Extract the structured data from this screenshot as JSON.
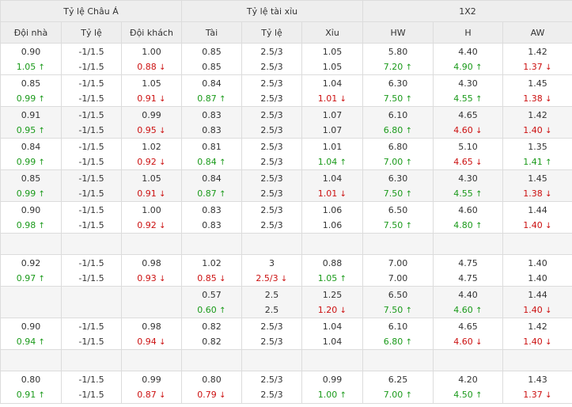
{
  "groups": [
    "Tỷ lệ Châu Á",
    "Tỷ lệ tài xỉu",
    "1X2"
  ],
  "columns": [
    "Đội nhà",
    "Tỷ lệ",
    "Đội khách",
    "Tài",
    "Tỷ lệ",
    "Xỉu",
    "HW",
    "H",
    "AW"
  ],
  "rows": [
    {
      "type": "data",
      "alt": false,
      "cells": [
        [
          {
            "v": "0.90",
            "c": ""
          },
          {
            "v": "1.05",
            "c": "up"
          }
        ],
        [
          {
            "v": "-1/1.5",
            "c": ""
          },
          {
            "v": "-1/1.5",
            "c": ""
          }
        ],
        [
          {
            "v": "1.00",
            "c": ""
          },
          {
            "v": "0.88",
            "c": "down"
          }
        ],
        [
          {
            "v": "0.85",
            "c": ""
          },
          {
            "v": "0.85",
            "c": ""
          }
        ],
        [
          {
            "v": "2.5/3",
            "c": ""
          },
          {
            "v": "2.5/3",
            "c": ""
          }
        ],
        [
          {
            "v": "1.05",
            "c": ""
          },
          {
            "v": "1.05",
            "c": ""
          }
        ],
        [
          {
            "v": "5.80",
            "c": ""
          },
          {
            "v": "7.20",
            "c": "up"
          }
        ],
        [
          {
            "v": "4.40",
            "c": ""
          },
          {
            "v": "4.90",
            "c": "up"
          }
        ],
        [
          {
            "v": "1.42",
            "c": ""
          },
          {
            "v": "1.37",
            "c": "down"
          }
        ]
      ]
    },
    {
      "type": "data",
      "alt": false,
      "cells": [
        [
          {
            "v": "0.85",
            "c": ""
          },
          {
            "v": "0.99",
            "c": "up"
          }
        ],
        [
          {
            "v": "-1/1.5",
            "c": ""
          },
          {
            "v": "-1/1.5",
            "c": ""
          }
        ],
        [
          {
            "v": "1.05",
            "c": ""
          },
          {
            "v": "0.91",
            "c": "down"
          }
        ],
        [
          {
            "v": "0.84",
            "c": ""
          },
          {
            "v": "0.87",
            "c": "up"
          }
        ],
        [
          {
            "v": "2.5/3",
            "c": ""
          },
          {
            "v": "2.5/3",
            "c": ""
          }
        ],
        [
          {
            "v": "1.04",
            "c": ""
          },
          {
            "v": "1.01",
            "c": "down"
          }
        ],
        [
          {
            "v": "6.30",
            "c": ""
          },
          {
            "v": "7.50",
            "c": "up"
          }
        ],
        [
          {
            "v": "4.30",
            "c": ""
          },
          {
            "v": "4.55",
            "c": "up"
          }
        ],
        [
          {
            "v": "1.45",
            "c": ""
          },
          {
            "v": "1.38",
            "c": "down"
          }
        ]
      ]
    },
    {
      "type": "data",
      "alt": true,
      "cells": [
        [
          {
            "v": "0.91",
            "c": ""
          },
          {
            "v": "0.95",
            "c": "up"
          }
        ],
        [
          {
            "v": "-1/1.5",
            "c": ""
          },
          {
            "v": "-1/1.5",
            "c": ""
          }
        ],
        [
          {
            "v": "0.99",
            "c": ""
          },
          {
            "v": "0.95",
            "c": "down"
          }
        ],
        [
          {
            "v": "0.83",
            "c": ""
          },
          {
            "v": "0.83",
            "c": ""
          }
        ],
        [
          {
            "v": "2.5/3",
            "c": ""
          },
          {
            "v": "2.5/3",
            "c": ""
          }
        ],
        [
          {
            "v": "1.07",
            "c": ""
          },
          {
            "v": "1.07",
            "c": ""
          }
        ],
        [
          {
            "v": "6.10",
            "c": ""
          },
          {
            "v": "6.80",
            "c": "up"
          }
        ],
        [
          {
            "v": "4.65",
            "c": ""
          },
          {
            "v": "4.60",
            "c": "down"
          }
        ],
        [
          {
            "v": "1.42",
            "c": ""
          },
          {
            "v": "1.40",
            "c": "down"
          }
        ]
      ]
    },
    {
      "type": "data",
      "alt": false,
      "cells": [
        [
          {
            "v": "0.84",
            "c": ""
          },
          {
            "v": "0.99",
            "c": "up"
          }
        ],
        [
          {
            "v": "-1/1.5",
            "c": ""
          },
          {
            "v": "-1/1.5",
            "c": ""
          }
        ],
        [
          {
            "v": "1.02",
            "c": ""
          },
          {
            "v": "0.92",
            "c": "down"
          }
        ],
        [
          {
            "v": "0.81",
            "c": ""
          },
          {
            "v": "0.84",
            "c": "up"
          }
        ],
        [
          {
            "v": "2.5/3",
            "c": ""
          },
          {
            "v": "2.5/3",
            "c": ""
          }
        ],
        [
          {
            "v": "1.01",
            "c": ""
          },
          {
            "v": "1.04",
            "c": "up"
          }
        ],
        [
          {
            "v": "6.80",
            "c": ""
          },
          {
            "v": "7.00",
            "c": "up"
          }
        ],
        [
          {
            "v": "5.10",
            "c": ""
          },
          {
            "v": "4.65",
            "c": "down"
          }
        ],
        [
          {
            "v": "1.35",
            "c": ""
          },
          {
            "v": "1.41",
            "c": "up"
          }
        ]
      ]
    },
    {
      "type": "data",
      "alt": true,
      "cells": [
        [
          {
            "v": "0.85",
            "c": ""
          },
          {
            "v": "0.99",
            "c": "up"
          }
        ],
        [
          {
            "v": "-1/1.5",
            "c": ""
          },
          {
            "v": "-1/1.5",
            "c": ""
          }
        ],
        [
          {
            "v": "1.05",
            "c": ""
          },
          {
            "v": "0.91",
            "c": "down"
          }
        ],
        [
          {
            "v": "0.84",
            "c": ""
          },
          {
            "v": "0.87",
            "c": "up"
          }
        ],
        [
          {
            "v": "2.5/3",
            "c": ""
          },
          {
            "v": "2.5/3",
            "c": ""
          }
        ],
        [
          {
            "v": "1.04",
            "c": ""
          },
          {
            "v": "1.01",
            "c": "down"
          }
        ],
        [
          {
            "v": "6.30",
            "c": ""
          },
          {
            "v": "7.50",
            "c": "up"
          }
        ],
        [
          {
            "v": "4.30",
            "c": ""
          },
          {
            "v": "4.55",
            "c": "up"
          }
        ],
        [
          {
            "v": "1.45",
            "c": ""
          },
          {
            "v": "1.38",
            "c": "down"
          }
        ]
      ]
    },
    {
      "type": "data",
      "alt": false,
      "cells": [
        [
          {
            "v": "0.90",
            "c": ""
          },
          {
            "v": "0.98",
            "c": "up"
          }
        ],
        [
          {
            "v": "-1/1.5",
            "c": ""
          },
          {
            "v": "-1/1.5",
            "c": ""
          }
        ],
        [
          {
            "v": "1.00",
            "c": ""
          },
          {
            "v": "0.92",
            "c": "down"
          }
        ],
        [
          {
            "v": "0.83",
            "c": ""
          },
          {
            "v": "0.83",
            "c": ""
          }
        ],
        [
          {
            "v": "2.5/3",
            "c": ""
          },
          {
            "v": "2.5/3",
            "c": ""
          }
        ],
        [
          {
            "v": "1.06",
            "c": ""
          },
          {
            "v": "1.06",
            "c": ""
          }
        ],
        [
          {
            "v": "6.50",
            "c": ""
          },
          {
            "v": "7.50",
            "c": "up"
          }
        ],
        [
          {
            "v": "4.60",
            "c": ""
          },
          {
            "v": "4.80",
            "c": "up"
          }
        ],
        [
          {
            "v": "1.44",
            "c": ""
          },
          {
            "v": "1.40",
            "c": "down"
          }
        ]
      ]
    },
    {
      "type": "blank",
      "alt": true
    },
    {
      "type": "data",
      "alt": false,
      "cells": [
        [
          {
            "v": "0.92",
            "c": ""
          },
          {
            "v": "0.97",
            "c": "up"
          }
        ],
        [
          {
            "v": "-1/1.5",
            "c": ""
          },
          {
            "v": "-1/1.5",
            "c": ""
          }
        ],
        [
          {
            "v": "0.98",
            "c": ""
          },
          {
            "v": "0.93",
            "c": "down"
          }
        ],
        [
          {
            "v": "1.02",
            "c": ""
          },
          {
            "v": "0.85",
            "c": "down"
          }
        ],
        [
          {
            "v": "3",
            "c": ""
          },
          {
            "v": "2.5/3",
            "c": "down"
          }
        ],
        [
          {
            "v": "0.88",
            "c": ""
          },
          {
            "v": "1.05",
            "c": "up"
          }
        ],
        [
          {
            "v": "7.00",
            "c": ""
          },
          {
            "v": "7.00",
            "c": ""
          }
        ],
        [
          {
            "v": "4.75",
            "c": ""
          },
          {
            "v": "4.75",
            "c": ""
          }
        ],
        [
          {
            "v": "1.40",
            "c": ""
          },
          {
            "v": "1.40",
            "c": ""
          }
        ]
      ]
    },
    {
      "type": "data",
      "alt": true,
      "cells": [
        [
          {
            "v": "",
            "c": ""
          },
          {
            "v": "",
            "c": ""
          }
        ],
        [
          {
            "v": "",
            "c": ""
          },
          {
            "v": "",
            "c": ""
          }
        ],
        [
          {
            "v": "",
            "c": ""
          },
          {
            "v": "",
            "c": ""
          }
        ],
        [
          {
            "v": "0.57",
            "c": ""
          },
          {
            "v": "0.60",
            "c": "up"
          }
        ],
        [
          {
            "v": "2.5",
            "c": ""
          },
          {
            "v": "2.5",
            "c": ""
          }
        ],
        [
          {
            "v": "1.25",
            "c": ""
          },
          {
            "v": "1.20",
            "c": "down"
          }
        ],
        [
          {
            "v": "6.50",
            "c": ""
          },
          {
            "v": "7.50",
            "c": "up"
          }
        ],
        [
          {
            "v": "4.40",
            "c": ""
          },
          {
            "v": "4.60",
            "c": "up"
          }
        ],
        [
          {
            "v": "1.44",
            "c": ""
          },
          {
            "v": "1.40",
            "c": "down"
          }
        ]
      ]
    },
    {
      "type": "data",
      "alt": false,
      "cells": [
        [
          {
            "v": "0.90",
            "c": ""
          },
          {
            "v": "0.94",
            "c": "up"
          }
        ],
        [
          {
            "v": "-1/1.5",
            "c": ""
          },
          {
            "v": "-1/1.5",
            "c": ""
          }
        ],
        [
          {
            "v": "0.98",
            "c": ""
          },
          {
            "v": "0.94",
            "c": "down"
          }
        ],
        [
          {
            "v": "0.82",
            "c": ""
          },
          {
            "v": "0.82",
            "c": ""
          }
        ],
        [
          {
            "v": "2.5/3",
            "c": ""
          },
          {
            "v": "2.5/3",
            "c": ""
          }
        ],
        [
          {
            "v": "1.04",
            "c": ""
          },
          {
            "v": "1.04",
            "c": ""
          }
        ],
        [
          {
            "v": "6.10",
            "c": ""
          },
          {
            "v": "6.80",
            "c": "up"
          }
        ],
        [
          {
            "v": "4.65",
            "c": ""
          },
          {
            "v": "4.60",
            "c": "down"
          }
        ],
        [
          {
            "v": "1.42",
            "c": ""
          },
          {
            "v": "1.40",
            "c": "down"
          }
        ]
      ]
    },
    {
      "type": "blank",
      "alt": true
    },
    {
      "type": "data",
      "alt": false,
      "last": true,
      "cells": [
        [
          {
            "v": "0.80",
            "c": ""
          },
          {
            "v": "0.91",
            "c": "up"
          }
        ],
        [
          {
            "v": "-1/1.5",
            "c": ""
          },
          {
            "v": "-1/1.5",
            "c": ""
          }
        ],
        [
          {
            "v": "0.99",
            "c": ""
          },
          {
            "v": "0.87",
            "c": "down"
          }
        ],
        [
          {
            "v": "0.80",
            "c": ""
          },
          {
            "v": "0.79",
            "c": "down"
          }
        ],
        [
          {
            "v": "2.5/3",
            "c": ""
          },
          {
            "v": "2.5/3",
            "c": ""
          }
        ],
        [
          {
            "v": "0.99",
            "c": ""
          },
          {
            "v": "1.00",
            "c": "up"
          }
        ],
        [
          {
            "v": "6.25",
            "c": ""
          },
          {
            "v": "7.00",
            "c": "up"
          }
        ],
        [
          {
            "v": "4.20",
            "c": ""
          },
          {
            "v": "4.50",
            "c": "up"
          }
        ],
        [
          {
            "v": "1.43",
            "c": ""
          },
          {
            "v": "1.37",
            "c": "down"
          }
        ]
      ]
    }
  ]
}
